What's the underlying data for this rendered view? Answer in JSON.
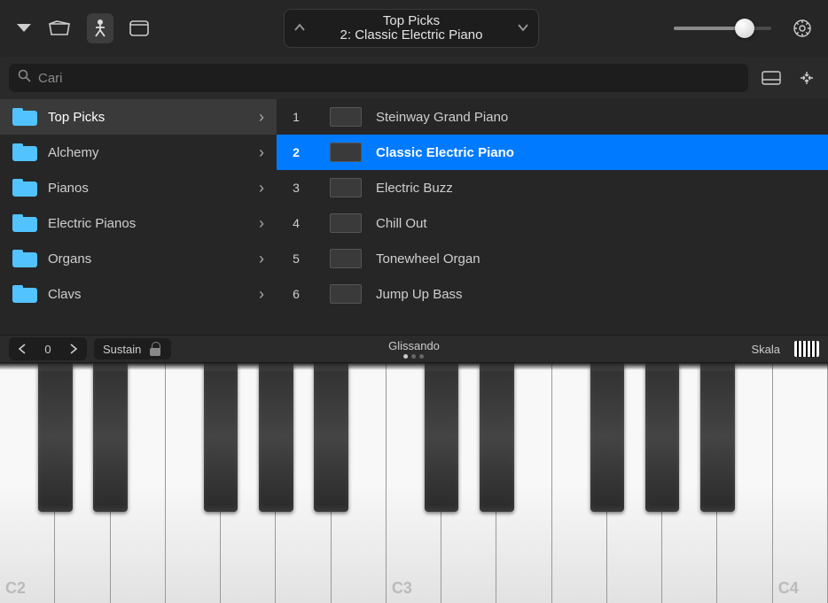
{
  "preset": {
    "title": "Top Picks",
    "subtitle": "2: Classic Electric Piano"
  },
  "search": {
    "placeholder": "Cari"
  },
  "categories": [
    {
      "label": "Top Picks",
      "selected": true
    },
    {
      "label": "Alchemy"
    },
    {
      "label": "Pianos"
    },
    {
      "label": "Electric Pianos"
    },
    {
      "label": "Organs"
    },
    {
      "label": "Clavs"
    }
  ],
  "instruments": [
    {
      "num": "1",
      "label": "Steinway Grand Piano"
    },
    {
      "num": "2",
      "label": "Classic Electric Piano",
      "selected": true
    },
    {
      "num": "3",
      "label": "Electric Buzz"
    },
    {
      "num": "4",
      "label": "Chill Out"
    },
    {
      "num": "5",
      "label": "Tonewheel Organ"
    },
    {
      "num": "6",
      "label": "Jump Up Bass"
    }
  ],
  "kbbar": {
    "octave": "0",
    "sustain": "Sustain",
    "mode": "Glissando",
    "skala": "Skala"
  },
  "octave_labels": {
    "c2": "C2",
    "c3": "C3",
    "c4": "C4"
  }
}
